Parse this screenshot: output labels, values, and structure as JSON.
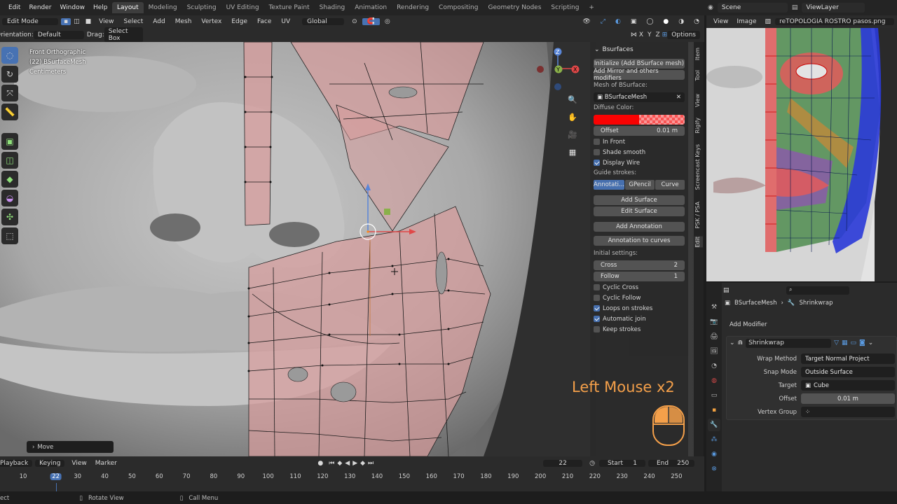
{
  "menu": [
    "Edit",
    "Render",
    "Window",
    "Help"
  ],
  "workspaces": [
    {
      "label": "Layout",
      "active": true
    },
    {
      "label": "Modeling"
    },
    {
      "label": "Sculpting"
    },
    {
      "label": "UV Editing"
    },
    {
      "label": "Texture Paint"
    },
    {
      "label": "Shading"
    },
    {
      "label": "Animation"
    },
    {
      "label": "Rendering"
    },
    {
      "label": "Compositing"
    },
    {
      "label": "Geometry Nodes"
    },
    {
      "label": "Scripting"
    }
  ],
  "add_workspace": "+",
  "scene": {
    "scene_name": "Scene",
    "view_layer": "ViewLayer"
  },
  "viewport_header": {
    "mode": "Edit Mode",
    "items": [
      "View",
      "Select",
      "Add",
      "Mesh",
      "Vertex",
      "Edge",
      "Face",
      "UV"
    ],
    "transform_orientation": "Global"
  },
  "tool_header": {
    "orientation_label": "Orientation:",
    "orientation_value": "Default",
    "drag_label": "Drag:",
    "drag_value": "Select Box",
    "axes": [
      "X",
      "Y",
      "Z"
    ],
    "options": "Options"
  },
  "viewport_info": {
    "view": "Front Orthographic",
    "object": "(22) BSurfaceMesh",
    "units": "Centimeters"
  },
  "gizmo_axes": {
    "x": "X",
    "y": "Y",
    "z": "Z"
  },
  "bsurfaces": {
    "title": "Bsurfaces",
    "init_button": "Initialize (Add BSurface mesh)",
    "mirror_button": "Add Mirror and others modifiers",
    "mesh_label": "Mesh of BSurface:",
    "mesh_value": "BSurfaceMesh",
    "diffuse_label": "Diffuse Color:",
    "offset_label": "Offset",
    "offset_value": "0.01 m",
    "in_front": "In Front",
    "shade_smooth": "Shade smooth",
    "display_wire": "Display Wire",
    "guide_label": "Guide strokes:",
    "guide_options": [
      "Annotati...",
      "GPencil",
      "Curve"
    ],
    "add_surface": "Add Surface",
    "edit_surface": "Edit Surface",
    "add_annotation": "Add Annotation",
    "annotation_to_curves": "Annotation to curves",
    "initial_label": "Initial settings:",
    "cross_label": "Cross",
    "cross_value": "2",
    "follow_label": "Follow",
    "follow_value": "1",
    "cyclic_cross": "Cyclic Cross",
    "cyclic_follow": "Cyclic Follow",
    "loops_on_strokes": "Loops on strokes",
    "automatic_join": "Automatic join",
    "keep_strokes": "Keep strokes",
    "colors": {
      "diffuse": "#ff0000",
      "accent": "#4772b3"
    }
  },
  "side_tabs": [
    "Item",
    "Tool",
    "View",
    "Rigify",
    "Screencast Keys",
    "PSK / PSA",
    "Edit"
  ],
  "overlay": {
    "keys_text": "Left Mouse x2",
    "color": "#f5a04a"
  },
  "last_op": "Move",
  "image_editor": {
    "items": [
      "View",
      "Image"
    ],
    "image_name": "reTOPOLOGIA ROSTRO pasos.png"
  },
  "properties": {
    "breadcrumb_object": "BSurfaceMesh",
    "breadcrumb_modifier": "Shrinkwrap",
    "add_modifier": "Add Modifier",
    "modifier_name": "Shrinkwrap",
    "wrap_method_label": "Wrap Method",
    "wrap_method_value": "Target Normal Project",
    "snap_mode_label": "Snap Mode",
    "snap_mode_value": "Outside Surface",
    "target_label": "Target",
    "target_value": "Cube",
    "offset_label": "Offset",
    "offset_value": "0.01 m",
    "vertex_group_label": "Vertex Group"
  },
  "timeline": {
    "items": [
      "Playback",
      "Keying",
      "View",
      "Marker"
    ],
    "current_frame": "22",
    "start_label": "Start",
    "start_value": "1",
    "end_label": "End",
    "end_value": "250",
    "ticks": [
      "10",
      "22",
      "30",
      "40",
      "50",
      "60",
      "70",
      "80",
      "90",
      "100",
      "110",
      "120",
      "130",
      "140",
      "150",
      "160",
      "170",
      "180",
      "190",
      "200",
      "210",
      "220",
      "230",
      "240",
      "250"
    ]
  },
  "statusbar": {
    "select": "ect",
    "rotate": "Rotate View",
    "call_menu": "Call Menu"
  }
}
